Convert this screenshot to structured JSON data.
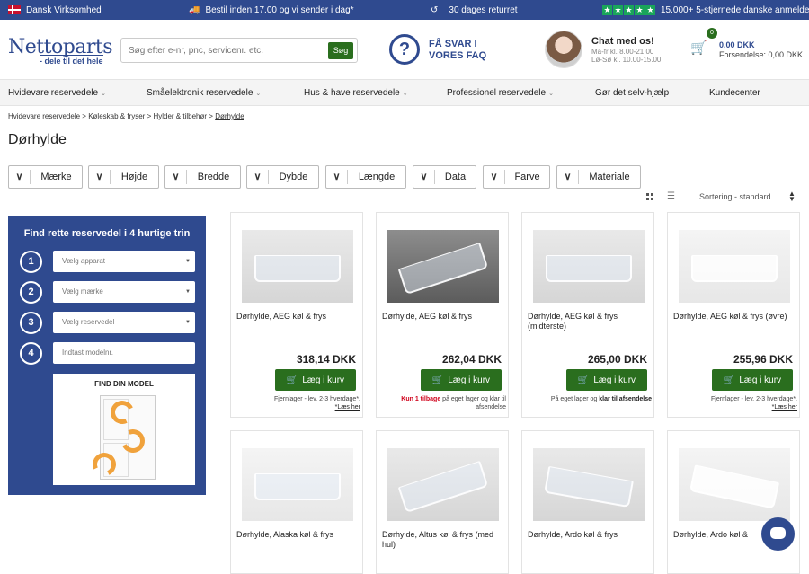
{
  "topbar": {
    "company": "Dansk Virksomhed",
    "shipping": "Bestil inden 17.00 og vi sender i dag*",
    "returns": "30 dages returret",
    "reviews": "15.000+ 5-stjernede danske anmeldelser"
  },
  "header": {
    "logo": "Nettoparts",
    "tagline": "- dele til det hele",
    "search_placeholder": "Søg efter e-nr, pnc, servicenr. etc.",
    "search_button": "Søg",
    "faq_label": "FÅ SVAR I VORES FAQ",
    "chat_title": "Chat med os!",
    "chat_hours_1": "Ma-fr kl. 8.00-21.00",
    "chat_hours_2": "Lø-Sø kl. 10.00-15.00",
    "cart_count": "0",
    "cart_total": "0,00 DKK",
    "cart_shipping": "Forsendelse: 0,00 DKK"
  },
  "nav": {
    "items": [
      "Hvidevare reservedele",
      "Småelektronik reservedele",
      "Hus & have reservedele",
      "Professionel reservedele",
      "Gør det selv-hjælp",
      "Kundecenter"
    ]
  },
  "breadcrumb": {
    "items": [
      "Hvidevare reservedele",
      "Køleskab & fryser",
      "Hylder & tilbehør",
      "Dørhylde"
    ],
    "separator": ">"
  },
  "page_title": "Dørhylde",
  "filters": [
    "Mærke",
    "Højde",
    "Bredde",
    "Dybde",
    "Længde",
    "Data",
    "Farve",
    "Materiale"
  ],
  "sort_label": "Sortering - standard",
  "finder": {
    "title": "Find rette reservedel i 4 hurtige trin",
    "steps": [
      "1",
      "2",
      "3",
      "4"
    ],
    "select_1": "Vælg apparat",
    "select_2": "Vælg mærke",
    "select_3": "Vælg reservedel",
    "model_input_placeholder": "Indtast modelnr.",
    "find_model": "FIND DIN MODEL"
  },
  "add_to_cart_label": "Læg i kurv",
  "products": [
    {
      "title": "Dørhylde, AEG køl & frys",
      "price": "318,14 DKK",
      "stock_text": "Fjernlager - lev. 2-3 hverdage*.",
      "stock_link": "*Læs her"
    },
    {
      "title": "Dørhylde, AEG køl & frys",
      "price": "262,04 DKK",
      "stock_alert": "Kun 1 tilbage",
      "stock_text": "på eget lager og klar til afsendelse"
    },
    {
      "title": "Dørhylde, AEG køl & frys (midterste)",
      "price": "265,00 DKK",
      "stock_text": "På eget lager og",
      "stock_bold": "klar til afsendelse"
    },
    {
      "title": "Dørhylde, AEG køl & frys (øvre)",
      "price": "255,96 DKK",
      "stock_text": "Fjernlager - lev. 2-3 hverdage*.",
      "stock_link": "*Læs her"
    },
    {
      "title": "Dørhylde, Alaska køl & frys"
    },
    {
      "title": "Dørhylde, Altus køl & frys (med hul)"
    },
    {
      "title": "Dørhylde, Ardo køl & frys"
    },
    {
      "title": "Dørhylde, Ardo køl &"
    }
  ],
  "colors": {
    "brand_blue": "#2f4a8f",
    "cart_green": "#2a6e1e",
    "alert_red": "#d0021b",
    "review_green": "#1aa55a"
  }
}
